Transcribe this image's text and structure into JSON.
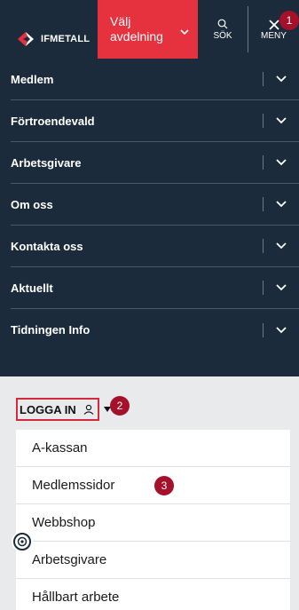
{
  "header": {
    "logo_text": "IFMETALL",
    "dept_button_label": "Välj avdelning",
    "search_label": "SÖK",
    "menu_label": "MENY"
  },
  "badges": [
    "1",
    "2",
    "3"
  ],
  "nav": {
    "items": [
      {
        "label": "Medlem"
      },
      {
        "label": "Förtroendevald"
      },
      {
        "label": "Arbetsgivare"
      },
      {
        "label": "Om oss"
      },
      {
        "label": "Kontakta oss"
      },
      {
        "label": "Aktuellt"
      },
      {
        "label": "Tidningen Info"
      }
    ]
  },
  "login": {
    "label": "LOGGA IN"
  },
  "links": {
    "items": [
      {
        "label": "A-kassan"
      },
      {
        "label": "Medlemssidor"
      },
      {
        "label": "Webbshop"
      },
      {
        "label": "Arbetsgivare"
      },
      {
        "label": "Hållbart arbete"
      }
    ]
  },
  "colors": {
    "navy": "#1b2b3b",
    "accent_red": "#e6323e",
    "badge_red": "#a5102b",
    "panel_gray": "#e8eaec"
  },
  "icons": {
    "logo": "ifmetall-logo-icon",
    "search": "search-icon",
    "close": "close-icon",
    "chevron": "chevron-down-icon",
    "user": "user-icon",
    "caret": "caret-down-icon",
    "accessibility": "accessibility-icon"
  }
}
